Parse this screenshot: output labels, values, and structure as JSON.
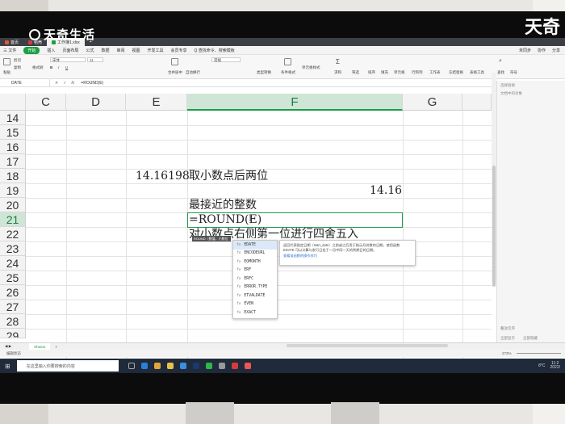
{
  "watermark": {
    "brand": "天奇生活",
    "corner": "天奇"
  },
  "titlebar": {
    "tabs": [
      {
        "label": "首页",
        "color": "#e0563b"
      },
      {
        "label": "稻壳",
        "color": "#d63b3b"
      },
      {
        "label": "工作簿1.xlsx",
        "color": "#1e9e44",
        "active": true
      },
      {
        "label": "+",
        "color": ""
      }
    ]
  },
  "menubar": {
    "items": [
      "三 文件",
      "开始",
      "插入",
      "页面布局",
      "公式",
      "数据",
      "审阅",
      "视图",
      "开发工具",
      "会员专享",
      "Q 查找命令、搜索模板"
    ],
    "active": "开始",
    "right": [
      "未同步",
      "协作",
      "分享"
    ]
  },
  "ribbon": {
    "cut": "剪切",
    "paste": "粘贴",
    "copy": "复制",
    "format_painter": "格式刷",
    "font": "宋体",
    "font_size": "11",
    "merge": "合并居中",
    "wrap": "自动换行",
    "number_format": "常规",
    "convert": "类型转换",
    "cond_format": "条件格式",
    "cell_style": "单元格样式",
    "sum": "求和",
    "filter": "筛选",
    "sort": "排序",
    "fill": "填充",
    "cell": "单元格",
    "row_col": "行和列",
    "sheet": "工作表",
    "freeze": "冻结窗格",
    "table_tools": "表格工具",
    "find": "查找",
    "symbol": "符号"
  },
  "formula_bar": {
    "name_box": "DATE",
    "fx": "fx",
    "content": "=ROUND(E)"
  },
  "columns": [
    {
      "label": "C"
    },
    {
      "label": "D"
    },
    {
      "label": "E"
    },
    {
      "label": "F",
      "active": true
    },
    {
      "label": "G"
    },
    {
      "label": "H"
    }
  ],
  "rows": [
    "14",
    "15",
    "16",
    "17",
    "18",
    "19",
    "20",
    "21",
    "22",
    "23",
    "24",
    "25",
    "26",
    "27",
    "28",
    "29"
  ],
  "active_row": "21",
  "cells": {
    "e18": "14.16198",
    "f18": "取小数点后两位",
    "f19": "14.16",
    "f20": "最接近的整数",
    "f21": "=ROUND(E)",
    "f22": "对小数点右侧第一位进行四舍五入"
  },
  "autocomplete": {
    "hint": "ROUND（数值，小数位数）",
    "items": [
      "EDATE",
      "ENCODEURL",
      "EOMONTH",
      "ERF",
      "ERFC",
      "ERROR.TYPE",
      "ETVALDATE",
      "EVEN",
      "EXACT"
    ],
    "active": "EDATE",
    "fx_label": "fx"
  },
  "tooltip": {
    "text": "返回代表指定日期（start_date）之前或之后用于指示月份数的日期。使用函数 EDATE 可以计算与发行日处于一月中同一天的到期日的日期。",
    "link": "查看该函数的操作技巧"
  },
  "side_panel": {
    "title": "选择窗格",
    "subtitle": "文档中的对象",
    "show_all": "全部显示",
    "hide_all": "全部隐藏",
    "order": "叠放次序"
  },
  "sheet": {
    "tab": "Sheet1",
    "add": "+"
  },
  "status": {
    "mode": "编辑状态",
    "zoom": "273%"
  },
  "taskbar": {
    "search_placeholder": "在这里输入你要搜索的内容",
    "weather": "8°C",
    "time": "11:2",
    "date": "2022/"
  }
}
